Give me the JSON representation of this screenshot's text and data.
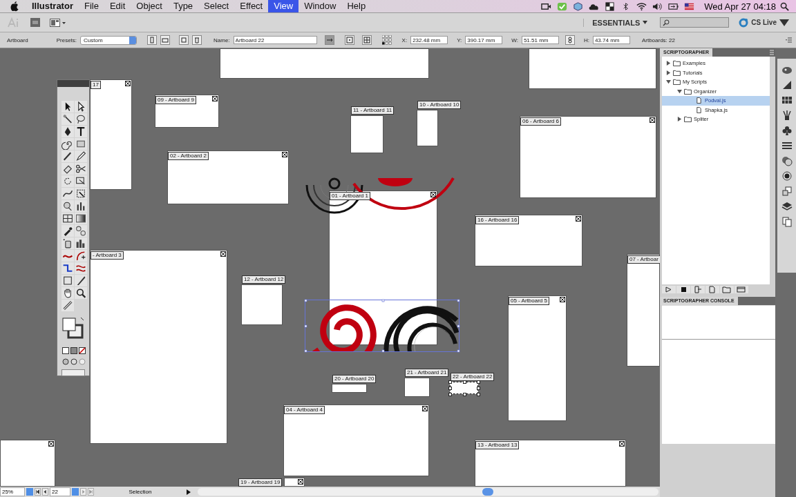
{
  "menu_bar": {
    "menus": [
      {
        "label": "Illustrator",
        "selected": false
      },
      {
        "label": "File",
        "selected": false
      },
      {
        "label": "Edit",
        "selected": false
      },
      {
        "label": "Object",
        "selected": false
      },
      {
        "label": "Type",
        "selected": false
      },
      {
        "label": "Select",
        "selected": false
      },
      {
        "label": "Effect",
        "selected": false
      },
      {
        "label": "View",
        "selected": true
      },
      {
        "label": "Window",
        "selected": false
      },
      {
        "label": "Help",
        "selected": false
      }
    ],
    "clock": "Wed Apr 27  04:18"
  },
  "app_bar": {
    "workspace": "ESSENTIALS",
    "cs_live": "CS Live"
  },
  "control_bar": {
    "mode": "Artboard",
    "presets_label": "Presets:",
    "preset": "Custom",
    "name_label": "Name:",
    "name": "Artboard 22",
    "fields": [
      {
        "label": "X:",
        "value": "232.48 mm"
      },
      {
        "label": "Y:",
        "value": "390.17 mm"
      },
      {
        "label": "W:",
        "value": "51.51 mm"
      },
      {
        "label": "H:",
        "value": "43.74 mm"
      }
    ],
    "artboard_count": "Artboards: 22"
  },
  "canvas": {
    "artboards": [
      {
        "selected": false
      },
      {
        "selected": false
      },
      {
        "label": "17",
        "selected": false
      },
      {
        "label": "09 - Artboard 9",
        "selected": false
      },
      {
        "label": "11 - Artboard 11",
        "selected": false
      },
      {
        "label": "10 - Artboard 10",
        "selected": false
      },
      {
        "label": "06 - Artboard 6",
        "selected": false
      },
      {
        "label": "02 - Artboard 2",
        "selected": false
      },
      {
        "label": "01 - Artboard 1",
        "selected": false
      },
      {
        "label": "16 - Artboard 16",
        "selected": false
      },
      {
        "label": "07 - Artboar",
        "selected": false
      },
      {
        "label": "- Artboard 3",
        "selected": false
      },
      {
        "label": "12 - Artboard 12",
        "selected": false
      },
      {
        "label": "05 - Artboard 5",
        "selected": false
      },
      {
        "label": "20 - Artboard 20",
        "selected": false
      },
      {
        "label": "21 - Artboard 21",
        "selected": false
      },
      {
        "label": "22 - Artboard 22",
        "selected": true
      },
      {
        "label": "04 - Artboard 4",
        "selected": false
      },
      {
        "label": "13 - Artboard 13",
        "selected": false
      },
      {
        "label": "19 - Artboard 19",
        "selected": false
      },
      {
        "selected": false
      }
    ]
  },
  "scriptographer": {
    "title": "SCRIPTOGRAPHER",
    "tree": [
      {
        "label": "Examples",
        "kind": "folder",
        "expanded": false,
        "selected": false
      },
      {
        "label": "Tutorials",
        "kind": "folder",
        "expanded": false,
        "selected": false
      },
      {
        "label": "My Scripts",
        "kind": "folder",
        "expanded": true,
        "selected": false,
        "children": [
          {
            "label": "Organizer",
            "kind": "folder",
            "expanded": true,
            "selected": false,
            "children": [
              {
                "label": "Podval.js",
                "kind": "file",
                "selected": true
              },
              {
                "label": "Shapka.js",
                "kind": "file",
                "selected": false
              }
            ]
          },
          {
            "label": "Spliter",
            "kind": "folder",
            "expanded": false,
            "selected": false
          }
        ]
      }
    ]
  },
  "console": {
    "title": "SCRIPTOGRAPHER CONSOLE"
  },
  "status_bar": {
    "zoom": "25%",
    "artboard": "22",
    "tool": "Selection"
  }
}
